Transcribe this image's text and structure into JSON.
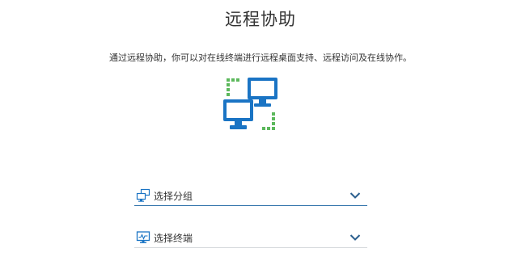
{
  "header": {
    "title": "远程协助",
    "description": "通过远程协助，你可以对在线终端进行远程桌面支持、远程访问及在线协作。"
  },
  "hero_icon": "remote-computers-icon",
  "selects": {
    "group": {
      "label": "选择分组",
      "icon": "group-computers-icon"
    },
    "terminal": {
      "label": "选择终端",
      "icon": "monitor-icon"
    }
  },
  "colors": {
    "accent": "#1a74c4",
    "dots": "#5cb85c",
    "border_active": "#2b6fa8",
    "border_idle": "#d5d8dc"
  }
}
